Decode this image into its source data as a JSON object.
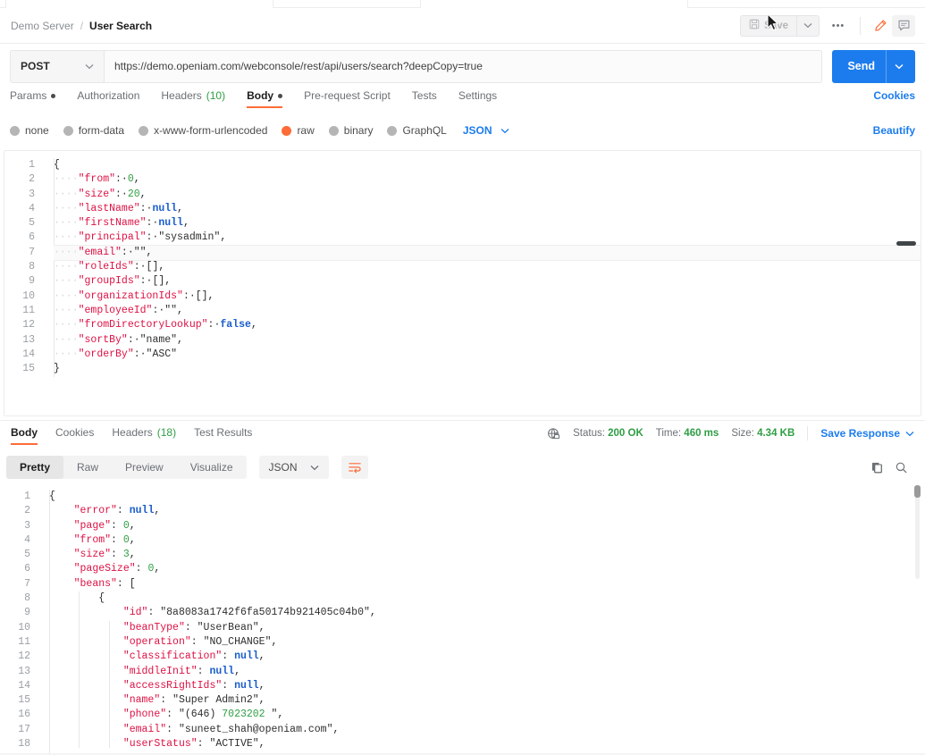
{
  "header": {
    "breadcrumb_server": "Demo Server",
    "breadcrumb_sep": "/",
    "breadcrumb_name": "User Search",
    "save_label": "Save",
    "save_caret": "⌄",
    "more_label": "•••",
    "edit_icon": "pencil-icon",
    "comment_icon": "comment-icon"
  },
  "url_bar": {
    "method": "POST",
    "method_caret": "⌄",
    "url": "https://demo.openiam.com/webconsole/rest/api/users/search?deepCopy=true",
    "send_label": "Send",
    "send_caret": "⌄"
  },
  "request_tabs": {
    "items": [
      {
        "label": "Params",
        "dot": true,
        "count": "",
        "active": false
      },
      {
        "label": "Authorization",
        "dot": false,
        "count": "",
        "active": false
      },
      {
        "label": "Headers",
        "dot": false,
        "count": "(10)",
        "active": false
      },
      {
        "label": "Body",
        "dot": true,
        "count": "",
        "active": true
      },
      {
        "label": "Pre-request Script",
        "dot": false,
        "count": "",
        "active": false
      },
      {
        "label": "Tests",
        "dot": false,
        "count": "",
        "active": false
      },
      {
        "label": "Settings",
        "dot": false,
        "count": "",
        "active": false
      }
    ],
    "cookies_link": "Cookies"
  },
  "body_types": {
    "options": [
      {
        "label": "none",
        "selected": false
      },
      {
        "label": "form-data",
        "selected": false
      },
      {
        "label": "x-www-form-urlencoded",
        "selected": false
      },
      {
        "label": "raw",
        "selected": true
      },
      {
        "label": "binary",
        "selected": false
      },
      {
        "label": "GraphQL",
        "selected": false
      }
    ],
    "format": "JSON",
    "format_caret": "⌄",
    "beautify_link": "Beautify"
  },
  "request_body": {
    "language": "json",
    "lines": [
      {
        "n": 1,
        "text": "{"
      },
      {
        "n": 2,
        "text": "    \"from\": 0,"
      },
      {
        "n": 3,
        "text": "    \"size\": 20,"
      },
      {
        "n": 4,
        "text": "    \"lastName\": null,"
      },
      {
        "n": 5,
        "text": "    \"firstName\": null,"
      },
      {
        "n": 6,
        "text": "    \"principal\": \"sysadmin\","
      },
      {
        "n": 7,
        "text": "    \"email\": \"\","
      },
      {
        "n": 8,
        "text": "    \"roleIds\": [],"
      },
      {
        "n": 9,
        "text": "    \"groupIds\": [],"
      },
      {
        "n": 10,
        "text": "    \"organizationIds\": [],"
      },
      {
        "n": 11,
        "text": "    \"employeeId\": \"\","
      },
      {
        "n": 12,
        "text": "    \"fromDirectoryLookup\": false,"
      },
      {
        "n": 13,
        "text": "    \"sortBy\": \"name\","
      },
      {
        "n": 14,
        "text": "    \"orderBy\": \"ASC\""
      },
      {
        "n": 15,
        "text": "}"
      }
    ],
    "highlighted_line": 7
  },
  "response_tabs": {
    "items": [
      {
        "label": "Body",
        "count": "",
        "active": true
      },
      {
        "label": "Cookies",
        "count": "",
        "active": false
      },
      {
        "label": "Headers",
        "count": "(18)",
        "active": false
      },
      {
        "label": "Test Results",
        "count": "",
        "active": false
      }
    ]
  },
  "response_meta": {
    "globe_icon": "globe-lock-icon",
    "status_label": "Status:",
    "status_value": "200 OK",
    "time_label": "Time:",
    "time_value": "460 ms",
    "size_label": "Size:",
    "size_value": "4.34 KB",
    "save_response": "Save Response",
    "save_response_caret": "⌄"
  },
  "response_view": {
    "modes": [
      {
        "label": "Pretty",
        "selected": true
      },
      {
        "label": "Raw",
        "selected": false
      },
      {
        "label": "Preview",
        "selected": false
      },
      {
        "label": "Visualize",
        "selected": false
      }
    ],
    "format": "JSON",
    "format_caret": "⌄",
    "wrap_icon": "wrap-lines-icon",
    "copy_icon": "copy-icon",
    "search_icon": "search-icon"
  },
  "response_body": {
    "language": "json",
    "lines": [
      {
        "n": 1,
        "text": "{"
      },
      {
        "n": 2,
        "text": "    \"error\": null,"
      },
      {
        "n": 3,
        "text": "    \"page\": 0,"
      },
      {
        "n": 4,
        "text": "    \"from\": 0,"
      },
      {
        "n": 5,
        "text": "    \"size\": 3,"
      },
      {
        "n": 6,
        "text": "    \"pageSize\": 0,"
      },
      {
        "n": 7,
        "text": "    \"beans\": ["
      },
      {
        "n": 8,
        "text": "        {"
      },
      {
        "n": 9,
        "text": "            \"id\": \"8a8083a1742f6fa50174b921405c04b0\","
      },
      {
        "n": 10,
        "text": "            \"beanType\": \"UserBean\","
      },
      {
        "n": 11,
        "text": "            \"operation\": \"NO_CHANGE\","
      },
      {
        "n": 12,
        "text": "            \"classification\": null,"
      },
      {
        "n": 13,
        "text": "            \"middleInit\": null,"
      },
      {
        "n": 14,
        "text": "            \"accessRightIds\": null,"
      },
      {
        "n": 15,
        "text": "            \"name\": \"Super Admin2\","
      },
      {
        "n": 16,
        "text": "            \"phone\": \"(646) 7023202 \","
      },
      {
        "n": 17,
        "text": "            \"email\": \"suneet_shah@openiam.com\","
      },
      {
        "n": 18,
        "text": "            \"userStatus\": \"ACTIVE\","
      }
    ]
  },
  "colors": {
    "accent_orange": "#ff6c37",
    "link_blue": "#1c7ced",
    "send_blue": "#1c7ced",
    "status_green": "#2f9e44",
    "json_key": "#d14",
    "json_number": "#2f9e44",
    "json_literal": "#1a5dcc"
  }
}
